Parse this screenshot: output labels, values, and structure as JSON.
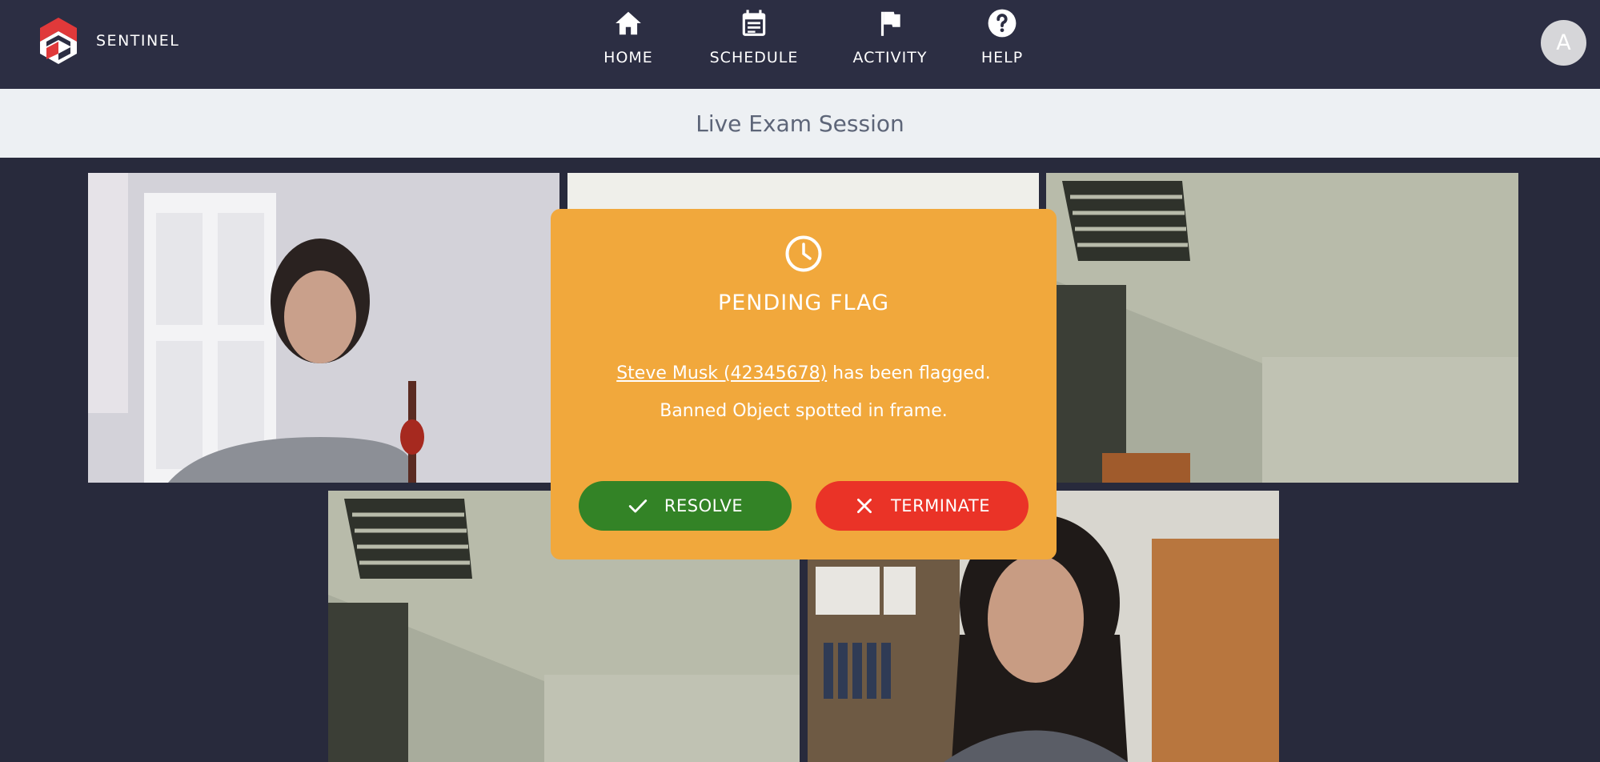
{
  "brand": {
    "name": "SENTINEL"
  },
  "nav": {
    "items": [
      {
        "label": "HOME",
        "icon": "home-icon"
      },
      {
        "label": "SCHEDULE",
        "icon": "calendar-icon"
      },
      {
        "label": "ACTIVITY",
        "icon": "flag-icon"
      },
      {
        "label": "HELP",
        "icon": "help-icon"
      }
    ]
  },
  "user": {
    "avatar_initial": "A"
  },
  "page": {
    "title": "Live Exam Session"
  },
  "flag_modal": {
    "icon": "clock-icon",
    "title": "PENDING FLAG",
    "student_link": "Steve Musk (42345678)",
    "flag_text": " has been flagged.",
    "reason": "Banned Object spotted in frame.",
    "resolve_label": "RESOLVE",
    "terminate_label": "TERMINATE"
  },
  "colors": {
    "topbar": "#2c2e43",
    "background": "#282a3c",
    "modal": "#f1a83c",
    "resolve": "#338326",
    "terminate": "#ea3327",
    "brand_red": "#e0393a"
  }
}
